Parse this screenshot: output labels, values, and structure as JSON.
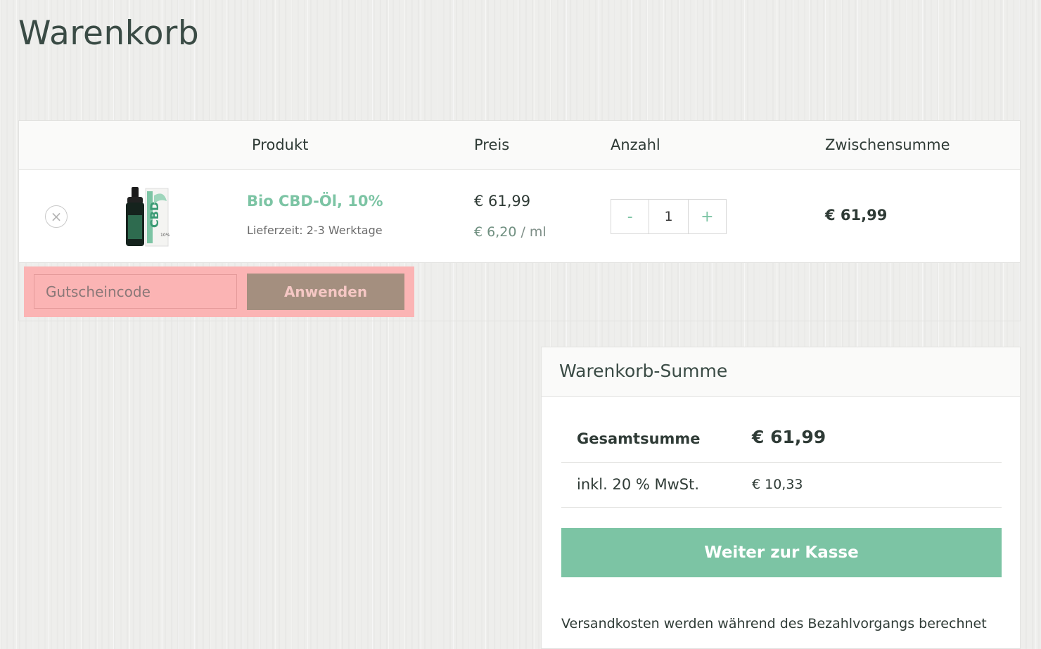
{
  "page_title": "Warenkorb",
  "cart": {
    "headers": {
      "product": "Produkt",
      "price": "Preis",
      "quantity": "Anzahl",
      "subtotal": "Zwischensumme"
    },
    "item": {
      "remove_symbol": "×",
      "product_name": "Bio CBD-Öl, 10%",
      "delivery_text": "Lieferzeit: 2-3 Werktage",
      "price": "€ 61,99",
      "unit_price": "€ 6,20",
      "unit_suffix": " / ml",
      "quantity": "1",
      "qty_minus": "-",
      "qty_plus": "+",
      "subtotal": "€ 61,99",
      "thumbnail_label": "CBD",
      "thumbnail_badge": "10%"
    }
  },
  "coupon": {
    "placeholder": "Gutscheincode",
    "apply_label": "Anwenden"
  },
  "totals": {
    "title": "Warenkorb-Summe",
    "rows": [
      {
        "label": "Gesamtsumme",
        "value": "€ 61,99"
      },
      {
        "label": "inkl. 20 % MwSt.",
        "value": "€ 10,33"
      }
    ],
    "checkout_label": "Weiter zur Kasse",
    "shipping_note": "Versandkosten werden während des Bezahlvorgangs berechnet"
  },
  "colors": {
    "accent": "#7cc4a4",
    "coupon_highlight": "#fbb4b4",
    "apply_button": "#a48f7f"
  }
}
